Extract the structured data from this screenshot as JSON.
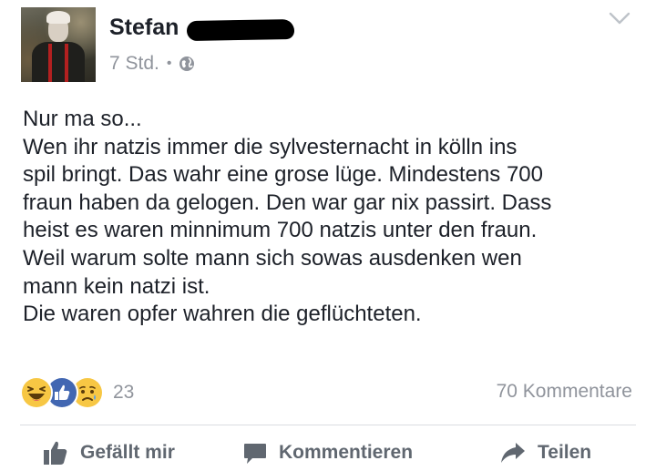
{
  "post": {
    "author": "Stefan",
    "timestamp": "7 Std.",
    "separator": "•",
    "privacy_icon": "globe-icon",
    "menu_icon": "chevron-down-icon",
    "lines": [
      "Nur ma so...",
      "Wen ihr natzis immer die sylvesternacht in kölln ins",
      "spil bringt. Das wahr eine grose lüge. Mindestens 700",
      "fraun haben da gelogen. Den war gar nix passirt. Dass",
      "heist es waren minnimum 700 natzis unter den fraun.",
      "Weil warum solte mann sich sowas ausdenken wen",
      "mann kein natzi ist.",
      "Die waren opfer wahren die geflüchteten."
    ]
  },
  "reactions": {
    "types": [
      "haha",
      "like",
      "sad"
    ],
    "count": "23"
  },
  "comments": {
    "label": "70 Kommentare"
  },
  "actions": {
    "like": "Gefällt mir",
    "comment": "Kommentieren",
    "share": "Teilen"
  },
  "colors": {
    "text": "#1d2129",
    "secondary": "#90949c",
    "action": "#606770",
    "like_blue": "#4267b2",
    "emoji_yellow": "#f7c744"
  }
}
